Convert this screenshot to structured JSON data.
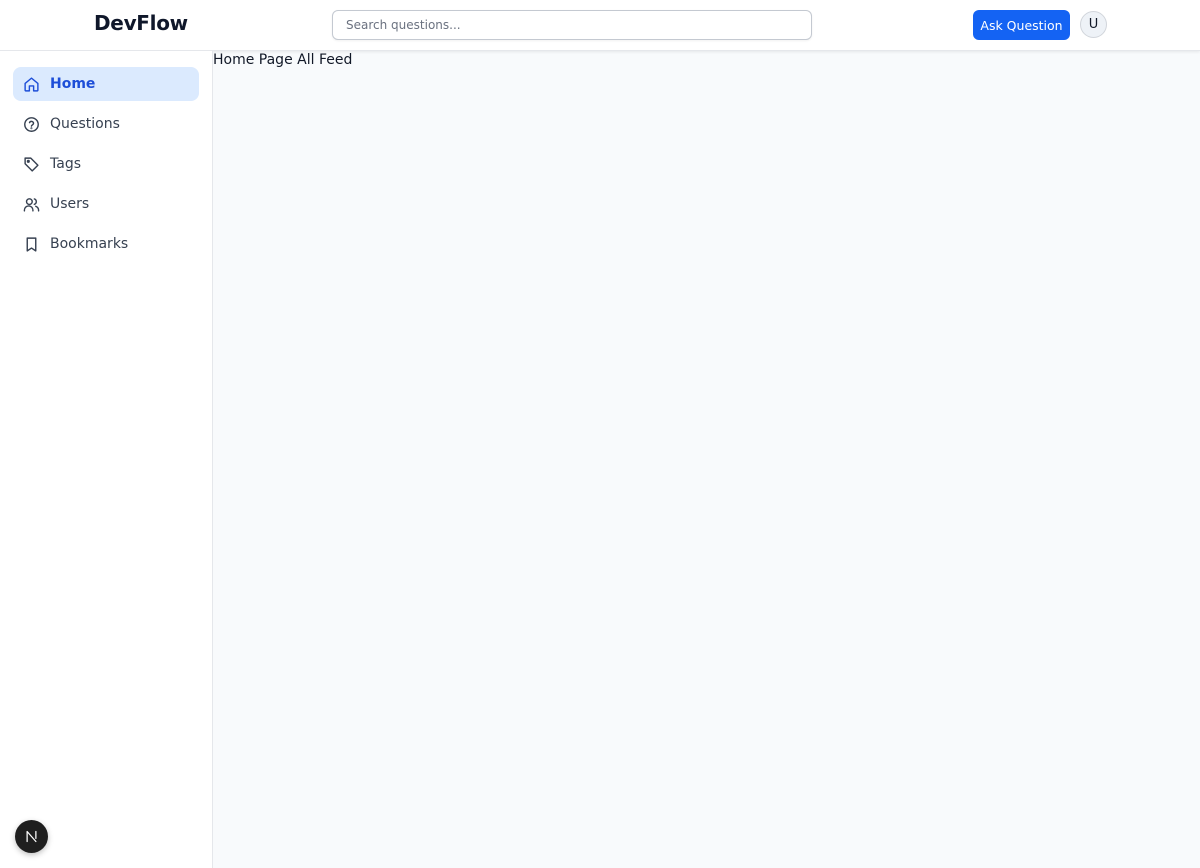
{
  "header": {
    "logo": "DevFlow",
    "search_placeholder": "Search questions...",
    "ask_button_label": "Ask Question",
    "avatar_initial": "U"
  },
  "sidebar": {
    "items": [
      {
        "label": "Home",
        "icon": "home-icon",
        "active": true
      },
      {
        "label": "Questions",
        "icon": "question-circle-icon",
        "active": false
      },
      {
        "label": "Tags",
        "icon": "tag-icon",
        "active": false
      },
      {
        "label": "Users",
        "icon": "users-icon",
        "active": false
      },
      {
        "label": "Bookmarks",
        "icon": "bookmark-icon",
        "active": false
      }
    ]
  },
  "main": {
    "heading": "Home Page All Feed"
  },
  "floating_badge": {
    "icon": "nextjs-n-icon"
  },
  "colors": {
    "accent": "#1463f3",
    "active_bg": "#dbeafe",
    "active_text": "#1d4ed8"
  }
}
